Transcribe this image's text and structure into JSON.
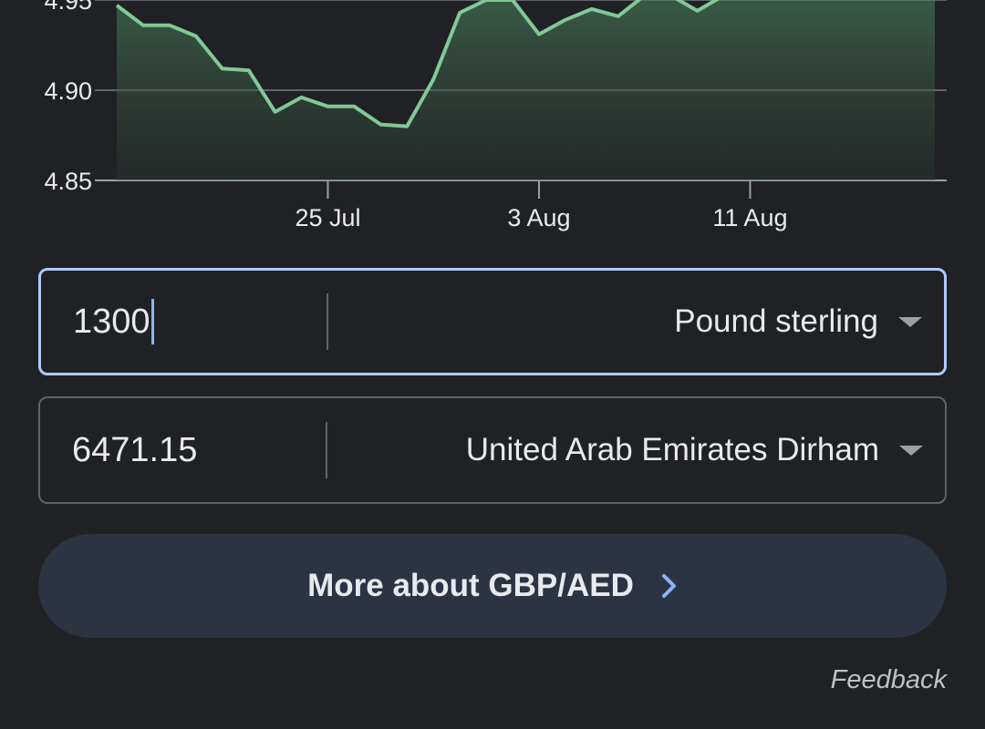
{
  "chart_data": {
    "type": "area",
    "y_ticks": [
      "4.85",
      "4.90",
      "4.95"
    ],
    "ylim": [
      4.85,
      4.95
    ],
    "x_ticks": [
      "25 Jul",
      "3 Aug",
      "11 Aug"
    ],
    "values": [
      4.947,
      4.936,
      4.936,
      4.93,
      4.912,
      4.911,
      4.888,
      4.896,
      4.891,
      4.891,
      4.881,
      4.88,
      4.906,
      4.943,
      4.95,
      4.95,
      4.931,
      4.939,
      4.945,
      4.941,
      4.957,
      4.957,
      4.944,
      4.96,
      4.96,
      4.96,
      4.96,
      4.96,
      4.96,
      4.96,
      4.96,
      4.96
    ],
    "line_color": "#81c995",
    "grid": true
  },
  "converter": {
    "from_amount": "1300",
    "from_currency": "Pound sterling",
    "to_amount": "6471.15",
    "to_currency": "United Arab Emirates Dirham"
  },
  "more_button_label": "More about GBP/AED",
  "feedback_label": "Feedback",
  "colors": {
    "background": "#202124",
    "active_border": "#aecbfa",
    "button_bg": "#2c3342",
    "accent": "#8ab4f8"
  }
}
